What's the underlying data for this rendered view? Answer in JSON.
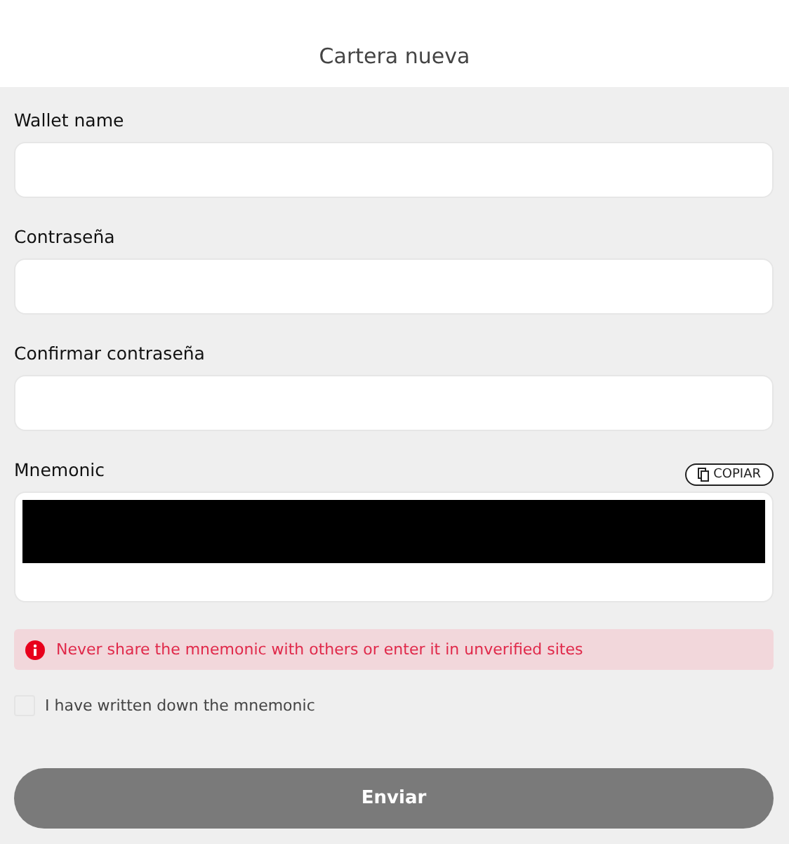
{
  "header": {
    "title": "Cartera nueva"
  },
  "fields": [
    {
      "label": "Wallet name"
    },
    {
      "label": "Contraseña"
    },
    {
      "label": "Confirmar contraseña"
    }
  ],
  "mnemonic": {
    "label": "Mnemonic",
    "copy_button": "COPIAR"
  },
  "alert": {
    "text": "Never share the mnemonic with others or enter it in unverified sites"
  },
  "confirm": {
    "label": "I have written down the mnemonic",
    "checked": false
  },
  "submit": {
    "label": "Enviar",
    "disabled": true
  }
}
